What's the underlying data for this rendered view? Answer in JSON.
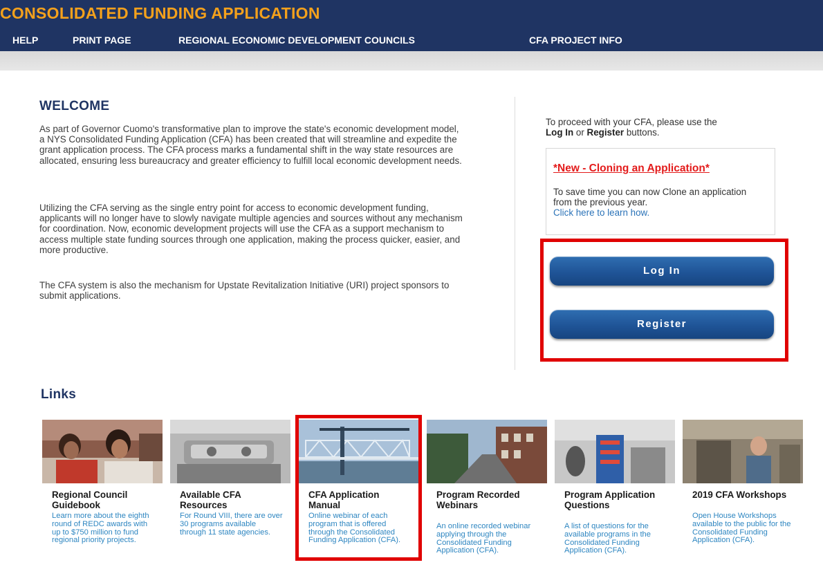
{
  "header": {
    "title": "CONSOLIDATED FUNDING APPLICATION",
    "nav": [
      "HELP",
      "PRINT PAGE",
      "REGIONAL ECONOMIC DEVELOPMENT COUNCILS",
      "CFA PROJECT INFO"
    ]
  },
  "welcome": {
    "title": "WELCOME",
    "paragraphs": [
      "As part of Governor Cuomo's transformative plan to improve the state's economic development model, a NYS Consolidated Funding Application (CFA) has been created that will streamline and expedite the grant application process. The CFA process marks a fundamental shift in the way state resources are allocated, ensuring less bureaucracy and greater efficiency to fulfill local economic development needs.",
      "Utilizing the CFA serving as the single entry point for access to economic development funding, applicants will no longer have to slowly navigate multiple agencies and sources without any mechanism for coordination. Now, economic development projects will use the CFA as a support mechanism to access multiple state funding sources through one application, making the process quicker, easier, and more productive.",
      "The CFA system is also the mechanism for Upstate Revitalization Initiative (URI) project sponsors to submit applications."
    ]
  },
  "sidebar": {
    "proceed_prefix": "To proceed with your CFA, please use the",
    "login_word": "Log In",
    "or_word": " or ",
    "register_word": "Register",
    "buttons_word": " buttons.",
    "clone_title": "*New - Cloning an Application*",
    "clone_text": "To save time you can now Clone an application from the previous year.",
    "clone_link": "Click here to learn how.",
    "login_button": "Log In",
    "register_button": "Register"
  },
  "links": {
    "title": "Links",
    "cards": [
      {
        "title": "Regional Council Guidebook",
        "desc": "Learn more about the eighth round of REDC awards with up to $750 million to fund regional priority projects."
      },
      {
        "title": "Available CFA Resources",
        "desc": "For Round VIII, there are over 30 programs available through 11 state agencies."
      },
      {
        "title": "CFA Application Manual",
        "desc": "Online webinar of each program that is offered through the Consolidated Funding Application (CFA)."
      },
      {
        "title": "Program Recorded Webinars",
        "desc": "An online recorded webinar applying through the Consolidated Funding Application (CFA)."
      },
      {
        "title": "Program Application Questions",
        "desc": "A list of questions for the available programs in the Consolidated Funding Application (CFA)."
      },
      {
        "title": "2019 CFA Workshops",
        "desc": "Open House Workshops available to the public for the Consolidated Funding Application (CFA)."
      }
    ]
  },
  "colors": {
    "header_bg": "#1f3463",
    "title_orange": "#f4a11c",
    "link_blue": "#2e86c1",
    "highlight_red": "#e00000",
    "button_blue": "#1f5497"
  }
}
